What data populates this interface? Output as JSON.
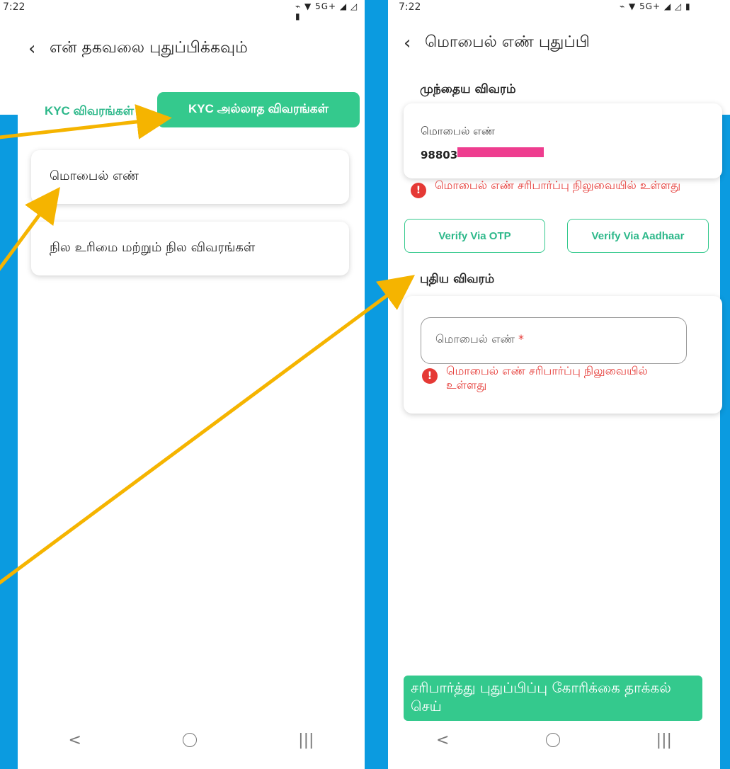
{
  "left": {
    "status": {
      "time": "7:22",
      "icons": "⌁ ▼ 5G+ ◢ ◿ ▮"
    },
    "title": "என் தகவலை புதுப்பிக்கவும்",
    "tabs": [
      {
        "label": "KYC விவரங்கள்",
        "active": false
      },
      {
        "label": "KYC அல்லாத விவரங்கள்",
        "active": true
      }
    ],
    "menu": [
      {
        "label": "மொபைல் எண்"
      },
      {
        "label": "நில உரிமை மற்றும் நில விவரங்கள்"
      }
    ]
  },
  "right": {
    "status": {
      "time": "7:22",
      "icons": "⌁ ▼ 5G+ ◢ ◿ ▮"
    },
    "title": "மொபைல் எண் புதுப்பி",
    "previous": {
      "section_title": "முந்தைய விவரம்",
      "label": "மொபைல் எண்",
      "value": "98803"
    },
    "error_text": "மொபைல் எண் சரிபார்ப்பு நிலுவையில் உள்ளது",
    "buttons": {
      "otp": "Verify Via OTP",
      "aadhaar": "Verify Via Aadhaar"
    },
    "new": {
      "section_title": "புதிய விவரம்",
      "placeholder": "மொபைல் எண்",
      "required_mark": "*",
      "error_text": "மொபைல் எண் சரிபார்ப்பு நிலுவையில் உள்ளது"
    },
    "submit_label": "சரிபார்த்து புதுப்பிப்பு கோரிக்கை தாக்கல் செய்"
  },
  "nav": {
    "back": "<",
    "home": "○",
    "recents": "|||"
  },
  "colors": {
    "accent": "#34c98d",
    "error": "#e53935",
    "arrow": "#f5b400",
    "mask": "#ee3d8f",
    "background": "#0b9be0"
  }
}
